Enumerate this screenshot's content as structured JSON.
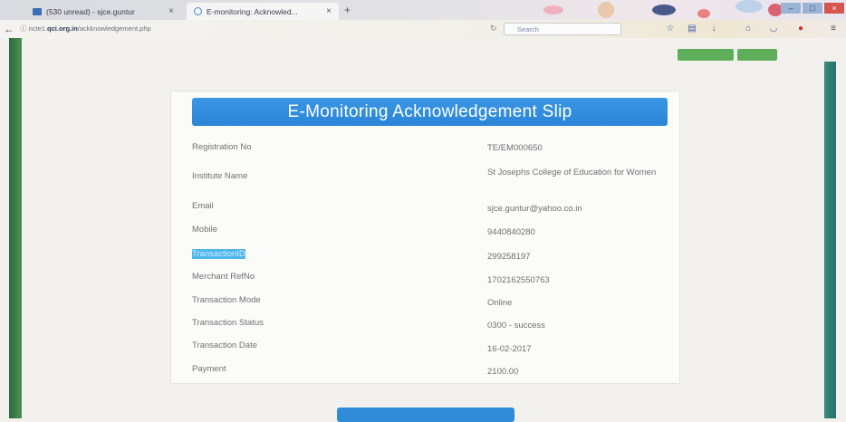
{
  "browser": {
    "tabs": [
      {
        "title": "(530 unread) - sjce.guntur",
        "active": false
      },
      {
        "title": "E-monitoring: Acknowled...",
        "active": true
      }
    ],
    "url_prefix": "ncte1.",
    "url_domain": "qci.org.in",
    "url_path": "/ackknowledgement.php",
    "search_placeholder": "Search"
  },
  "slip": {
    "title": "E-Monitoring Acknowledgement Slip",
    "rows": [
      {
        "label": "Registration No",
        "value": "TE/EM000650"
      },
      {
        "label": "Institute Name",
        "value": "St Josephs College of Education for Women"
      },
      {
        "label": "Email",
        "value": "sjce.guntur@yahoo.co.in"
      },
      {
        "label": "Mobile",
        "value": "9440840280"
      },
      {
        "label": "TransactionID",
        "value": "299258197"
      },
      {
        "label": "Merchant RefNo",
        "value": "1702162550763"
      },
      {
        "label": "Transaction Mode",
        "value": "Online"
      },
      {
        "label": "Transaction Status",
        "value": "0300 - success"
      },
      {
        "label": "Transaction Date",
        "value": "16-02-2017"
      },
      {
        "label": "Payment",
        "value": "2100.00"
      }
    ]
  },
  "colors": {
    "title_bar": "#2b84d6",
    "highlight": "#4fb7ec",
    "sidebar_left": "#2f6b3c",
    "sidebar_right": "#256f6a"
  }
}
